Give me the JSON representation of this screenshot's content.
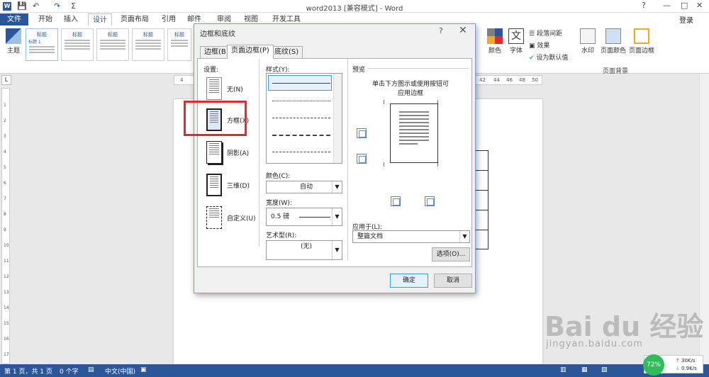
{
  "window": {
    "title": "word2013 [兼容模式] - Word",
    "help": "?",
    "minimize": "—",
    "restore": "□",
    "close": "✕",
    "login": "登录"
  },
  "quick_access": {
    "save": "💾",
    "undo": "↶",
    "redo": "↷",
    "sigma": "Σ"
  },
  "tabs": [
    "文件",
    "开始",
    "插入",
    "设计",
    "页面布局",
    "引用",
    "邮件",
    "审阅",
    "视图",
    "开发工具"
  ],
  "ribbon": {
    "theme": "主题",
    "style_title": "标题",
    "style_sub": "标题 1",
    "para_spacing": "段落间距",
    "effects": "效果",
    "set_default": "设为默认值",
    "colors": "颜色",
    "fonts": "字体",
    "watermark": "水印",
    "page_color": "页面颜色",
    "page_border": "页面边框",
    "group_page_bg": "页面背景"
  },
  "ruler_h": [
    "4",
    "42",
    "44",
    "46",
    "48",
    "50"
  ],
  "ruler_v": [
    "1",
    "2",
    "3",
    "4",
    "5",
    "6",
    "7",
    "8",
    "9",
    "10",
    "11",
    "12",
    "13",
    "14",
    "15",
    "16",
    "17"
  ],
  "dialog": {
    "title": "边框和底纹",
    "help": "?",
    "close": "✕",
    "tabs": [
      "边框(B)",
      "页面边框(P)",
      "底纹(S)"
    ],
    "settings_label": "设置:",
    "settings": [
      "无(N)",
      "方框(X)",
      "阴影(A)",
      "三维(D)",
      "自定义(U)"
    ],
    "style_label": "样式(Y):",
    "color_label": "颜色(C):",
    "color_value": "自动",
    "width_label": "宽度(W):",
    "width_value": "0.5 磅",
    "art_label": "艺术型(R):",
    "art_value": "(无)",
    "preview_label": "预览",
    "preview_hint_1": "单击下方图示或使用按钮可",
    "preview_hint_2": "应用边框",
    "apply_label": "应用于(L):",
    "apply_value": "整篇文档",
    "options": "选项(O)...",
    "ok": "确定",
    "cancel": "取消"
  },
  "status": {
    "page": "第 1 页，共 1 页",
    "words": "0 个字",
    "lang": "中文(中国)"
  },
  "watermark": {
    "brand": "Bai du 经验",
    "url": "jingyan.baidu.com"
  },
  "net": {
    "percent": "72%",
    "up": "30K/s",
    "down": "0.9K/s"
  }
}
